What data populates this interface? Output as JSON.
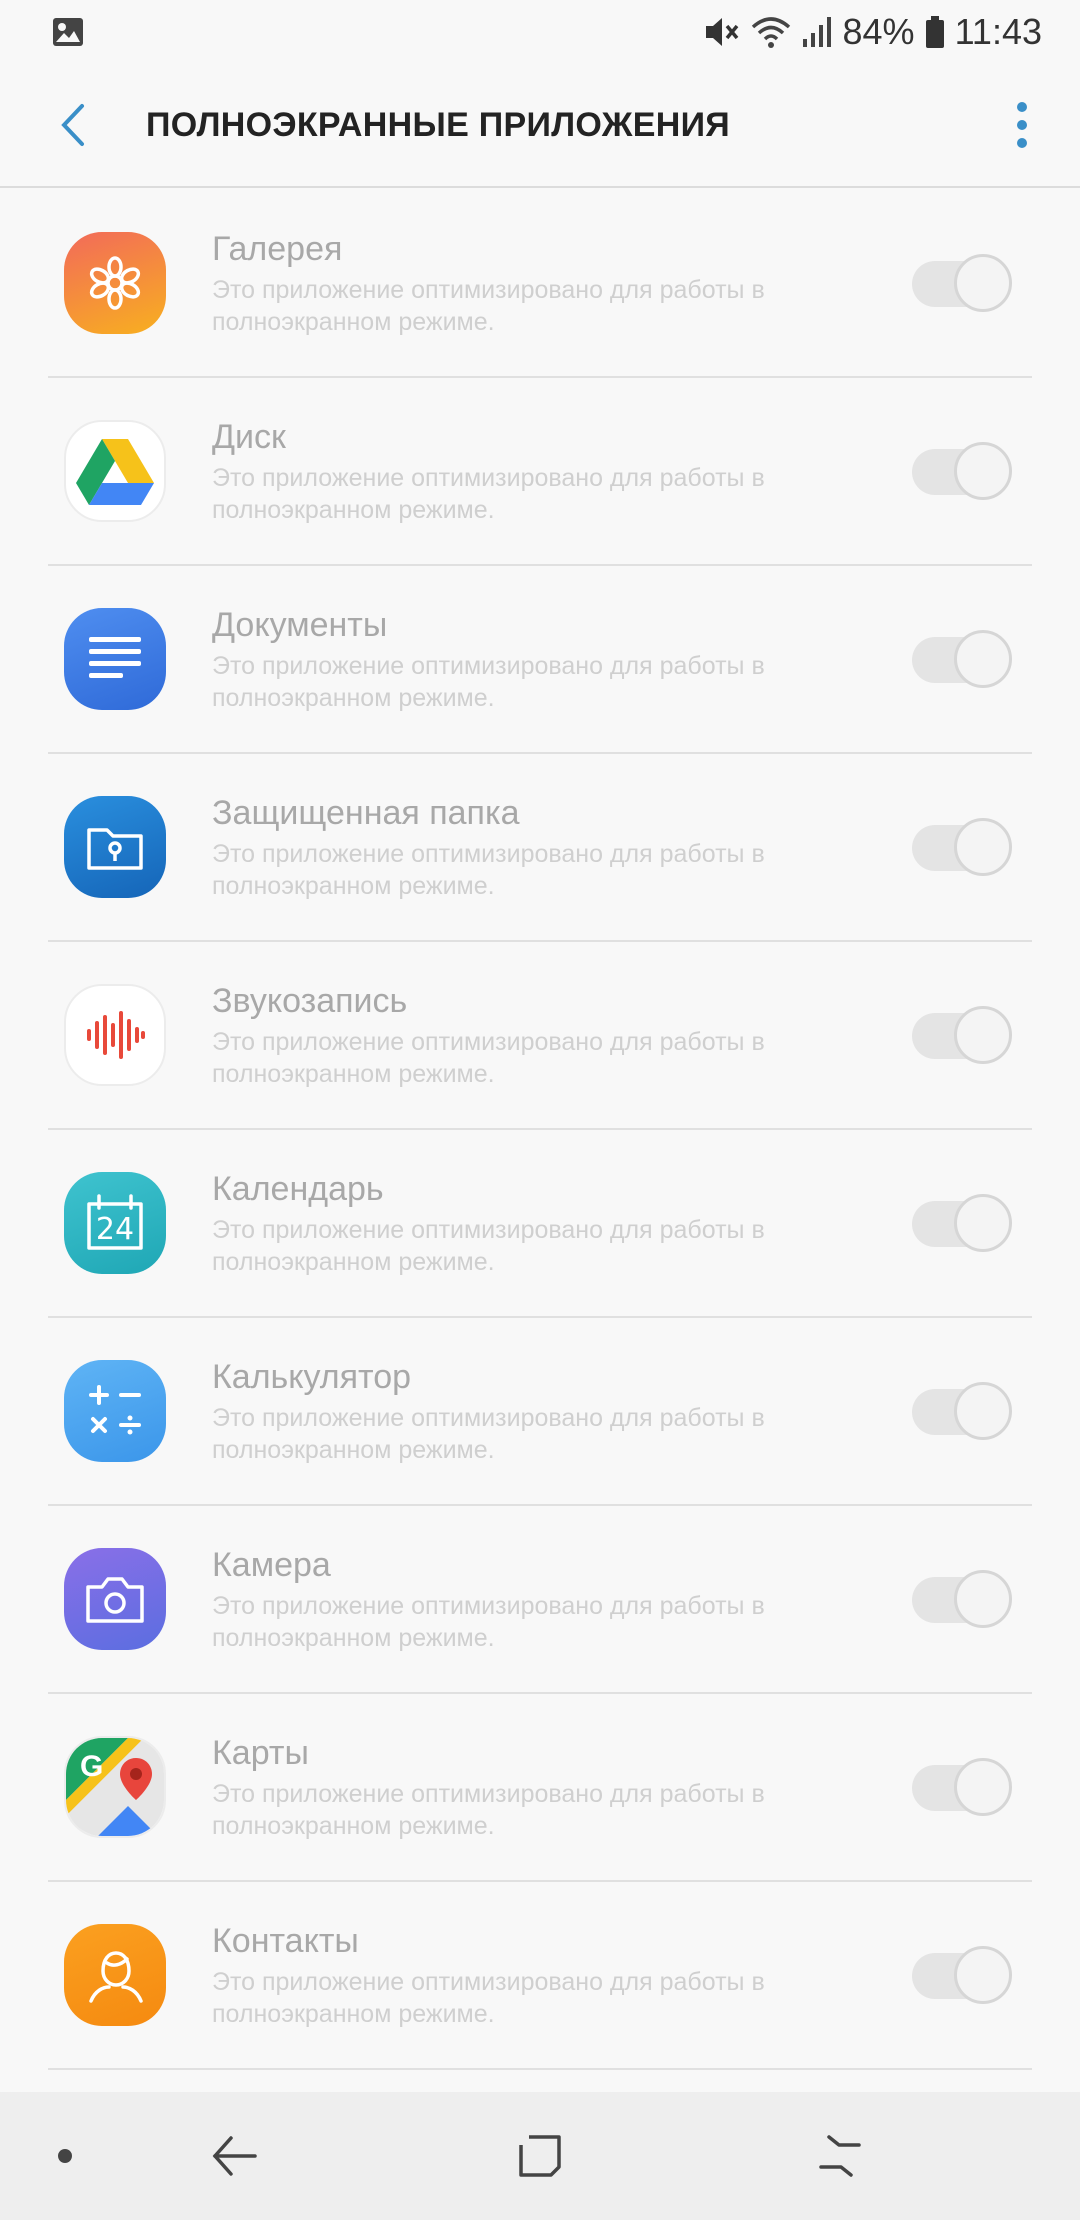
{
  "status_bar": {
    "battery": "84%",
    "time": "11:43",
    "icons": [
      "image-notification-icon",
      "mute-icon",
      "wifi-icon",
      "signal-icon",
      "battery-icon"
    ]
  },
  "app_bar": {
    "title": "ПОЛНОЭКРАННЫЕ ПРИЛОЖЕНИЯ",
    "accent": "#3a8fc8"
  },
  "apps": [
    {
      "name": "Галерея",
      "desc": "Это приложение оптимизировано для работы в полноэкранном режиме.",
      "icon": "gallery-icon",
      "toggle_on": false
    },
    {
      "name": "Диск",
      "desc": "Это приложение оптимизировано для работы в полноэкранном режиме.",
      "icon": "drive-icon",
      "toggle_on": false
    },
    {
      "name": "Документы",
      "desc": "Это приложение оптимизировано для работы в полноэкранном режиме.",
      "icon": "docs-icon",
      "toggle_on": false
    },
    {
      "name": "Защищенная папка",
      "desc": "Это приложение оптимизировано для работы в полноэкранном режиме.",
      "icon": "secure-folder-icon",
      "toggle_on": false
    },
    {
      "name": "Звукозапись",
      "desc": "Это приложение оптимизировано для работы в полноэкранном режиме.",
      "icon": "voice-recorder-icon",
      "toggle_on": false
    },
    {
      "name": "Календарь",
      "desc": "Это приложение оптимизировано для работы в полноэкранном режиме.",
      "icon": "calendar-icon",
      "icon_text": "24",
      "toggle_on": false
    },
    {
      "name": "Калькулятор",
      "desc": "Это приложение оптимизировано для работы в полноэкранном режиме.",
      "icon": "calculator-icon",
      "toggle_on": false
    },
    {
      "name": "Камера",
      "desc": "Это приложение оптимизировано для работы в полноэкранном режиме.",
      "icon": "camera-icon",
      "toggle_on": false
    },
    {
      "name": "Карты",
      "desc": "Это приложение оптимизировано для работы в полноэкранном режиме.",
      "icon": "maps-icon",
      "icon_text": "G",
      "toggle_on": false
    },
    {
      "name": "Контакты",
      "desc": "Это приложение оптимизировано для работы в полноэкранном режиме.",
      "icon": "contacts-icon",
      "toggle_on": false
    }
  ],
  "nav_bar": {
    "icons": [
      "nav-dot-icon",
      "back-arrow-icon",
      "home-icon",
      "recents-icon"
    ]
  }
}
